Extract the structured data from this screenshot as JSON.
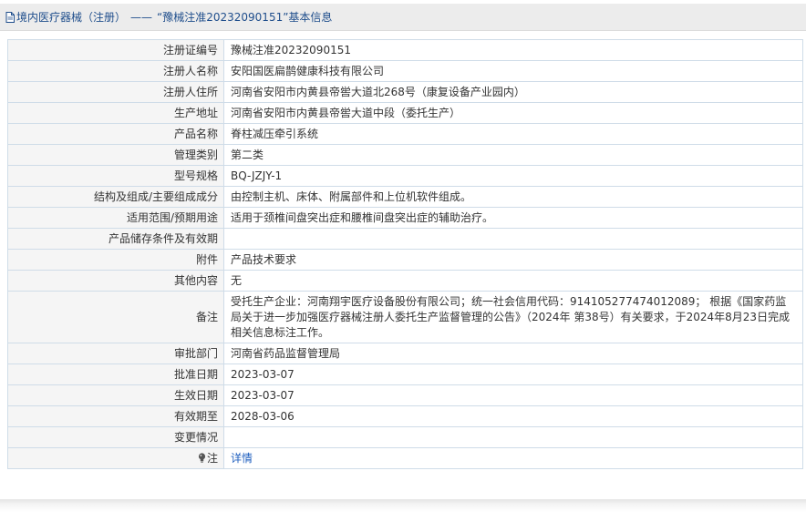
{
  "header": {
    "category": "境内医疗器械（注册）",
    "separator": "——",
    "record_title": "“豫械注准20232090151”基本信息"
  },
  "rows": [
    {
      "label": "注册证编号",
      "value": "豫械注准20232090151"
    },
    {
      "label": "注册人名称",
      "value": "安阳国医扁鹊健康科技有限公司"
    },
    {
      "label": "注册人住所",
      "value": "河南省安阳市内黄县帝喾大道北268号（康复设备产业园内）"
    },
    {
      "label": "生产地址",
      "value": "河南省安阳市内黄县帝喾大道中段（委托生产）"
    },
    {
      "label": "产品名称",
      "value": "脊柱减压牵引系统"
    },
    {
      "label": "管理类别",
      "value": "第二类"
    },
    {
      "label": "型号规格",
      "value": "BQ-JZJY-1"
    },
    {
      "label": "结构及组成/主要组成成分",
      "value": "由控制主机、床体、附属部件和上位机软件组成。"
    },
    {
      "label": "适用范围/预期用途",
      "value": "适用于颈椎间盘突出症和腰椎间盘突出症的辅助治疗。"
    },
    {
      "label": "产品储存条件及有效期",
      "value": ""
    },
    {
      "label": "附件",
      "value": "产品技术要求"
    },
    {
      "label": "其他内容",
      "value": "无"
    },
    {
      "label": "备注",
      "value": "受托生产企业：河南翔宇医疗设备股份有限公司；统一社会信用代码：914105277474012089；  根据《国家药监局关于进一步加强医疗器械注册人委托生产监督管理的公告》（2024年 第38号）有关要求，于2024年8月23日完成相关信息标注工作。"
    },
    {
      "label": "审批部门",
      "value": "河南省药品监督管理局"
    },
    {
      "label": "批准日期",
      "value": "2023-03-07"
    },
    {
      "label": "生效日期",
      "value": "2023-03-07"
    },
    {
      "label": "有效期至",
      "value": "2028-03-06"
    },
    {
      "label": "变更情况",
      "value": ""
    }
  ],
  "note": {
    "label": "注",
    "icon": "lightbulb-icon",
    "link_text": "详情"
  },
  "colors": {
    "header_bg": "#ececec",
    "header_text": "#1f4e8c",
    "border": "#cfdce8",
    "label_bg": "#f5f5f5",
    "link": "#1f5fbf"
  }
}
